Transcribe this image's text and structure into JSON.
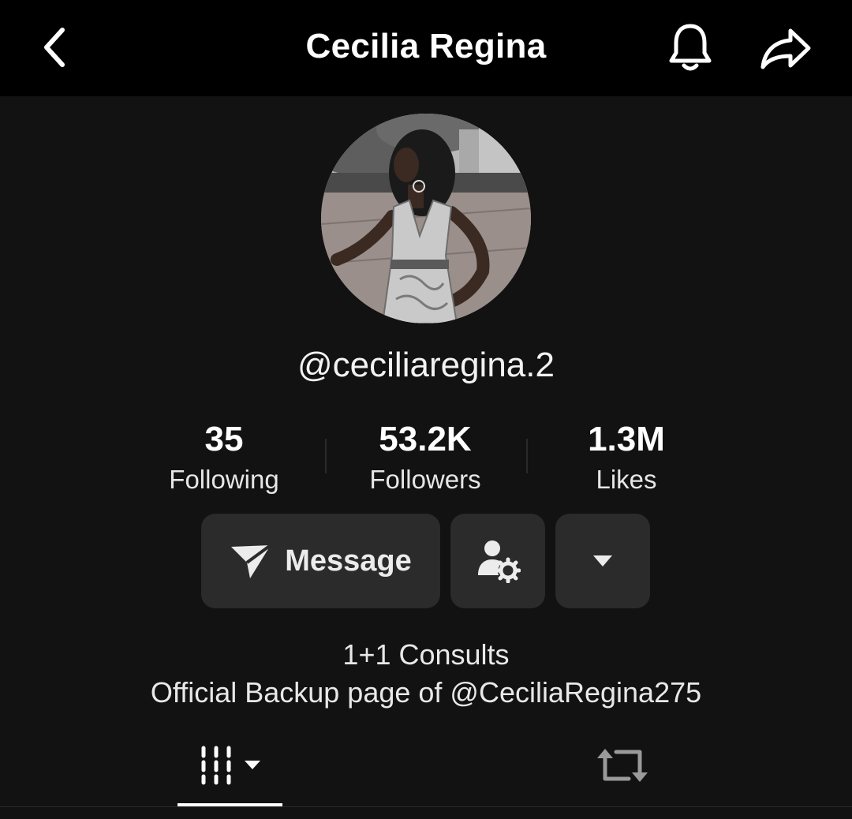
{
  "header": {
    "title": "Cecilia Regina",
    "back_icon": "chevron-left-icon",
    "notification_icon": "bell-icon",
    "share_icon": "share-arrow-icon"
  },
  "profile": {
    "username": "@ceciliaregina.2",
    "avatar_description": "profile-photo"
  },
  "stats": [
    {
      "value": "35",
      "label": "Following"
    },
    {
      "value": "53.2K",
      "label": "Followers"
    },
    {
      "value": "1.3M",
      "label": "Likes"
    }
  ],
  "actions": {
    "message_label": "Message",
    "message_icon": "paper-plane-icon",
    "friend_settings_icon": "person-gear-icon",
    "more_icon": "caret-down-icon"
  },
  "bio": {
    "line1": "1+1 Consults",
    "line2": "Official Backup page of @CeciliaRegina275"
  },
  "tabs": {
    "videos_icon": "grid-filter-icon",
    "reposts_icon": "repost-icon",
    "active": "videos"
  },
  "colors": {
    "background": "#121212",
    "topbar": "#000000",
    "button_bg": "#2b2b2b",
    "text": "#ffffff"
  }
}
